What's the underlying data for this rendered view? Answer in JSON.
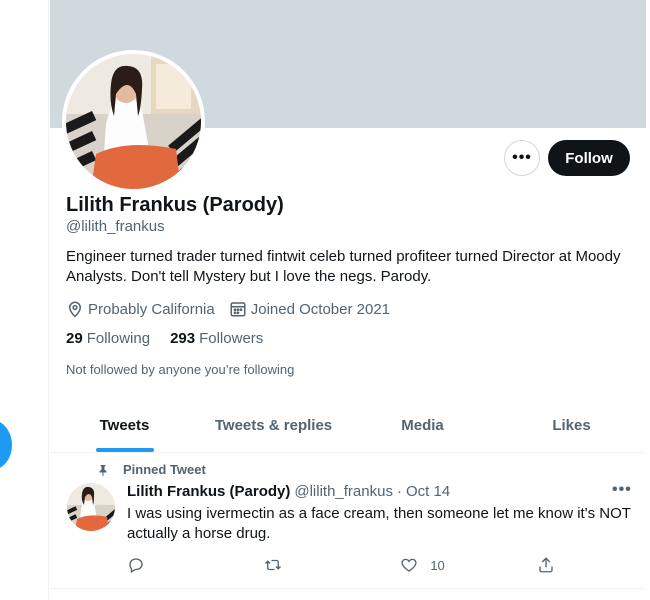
{
  "profile": {
    "display_name": "Lilith Frankus (Parody)",
    "handle": "@lilith_frankus",
    "bio": "Engineer turned trader turned fintwit celeb turned profiteer turned Director at Moody Analysts. Don't tell Mystery but I love the negs. Parody.",
    "location": "Probably California",
    "joined": "Joined October 2021",
    "following_count": "29",
    "following_label": "Following",
    "followers_count": "293",
    "followers_label": "Followers",
    "followed_by_note": "Not followed by anyone you’re following"
  },
  "actions": {
    "more_label": "•••",
    "follow_label": "Follow"
  },
  "tabs": [
    {
      "label": "Tweets",
      "active": true
    },
    {
      "label": "Tweets & replies",
      "active": false
    },
    {
      "label": "Media",
      "active": false
    },
    {
      "label": "Likes",
      "active": false
    }
  ],
  "pinned_tweet": {
    "pinned_label": "Pinned Tweet",
    "name": "Lilith Frankus (Parody)",
    "handle": "@lilith_frankus",
    "separator": "·",
    "date": "Oct 14",
    "more_label": "•••",
    "text": "I was using ivermectin as a face cream, then someone let me know it's NOT actually a horse drug.",
    "reply_count": "",
    "retweet_count": "",
    "like_count": "10"
  },
  "icons": {
    "location": "location-pin-icon",
    "calendar": "calendar-icon",
    "pin": "pin-icon",
    "reply": "reply-icon",
    "retweet": "retweet-icon",
    "like": "heart-icon",
    "share": "share-icon"
  },
  "colors": {
    "accent": "#1d9bf0",
    "banner": "#cfd9de",
    "follow_button": "#0f1419",
    "secondary_text": "#536471"
  }
}
